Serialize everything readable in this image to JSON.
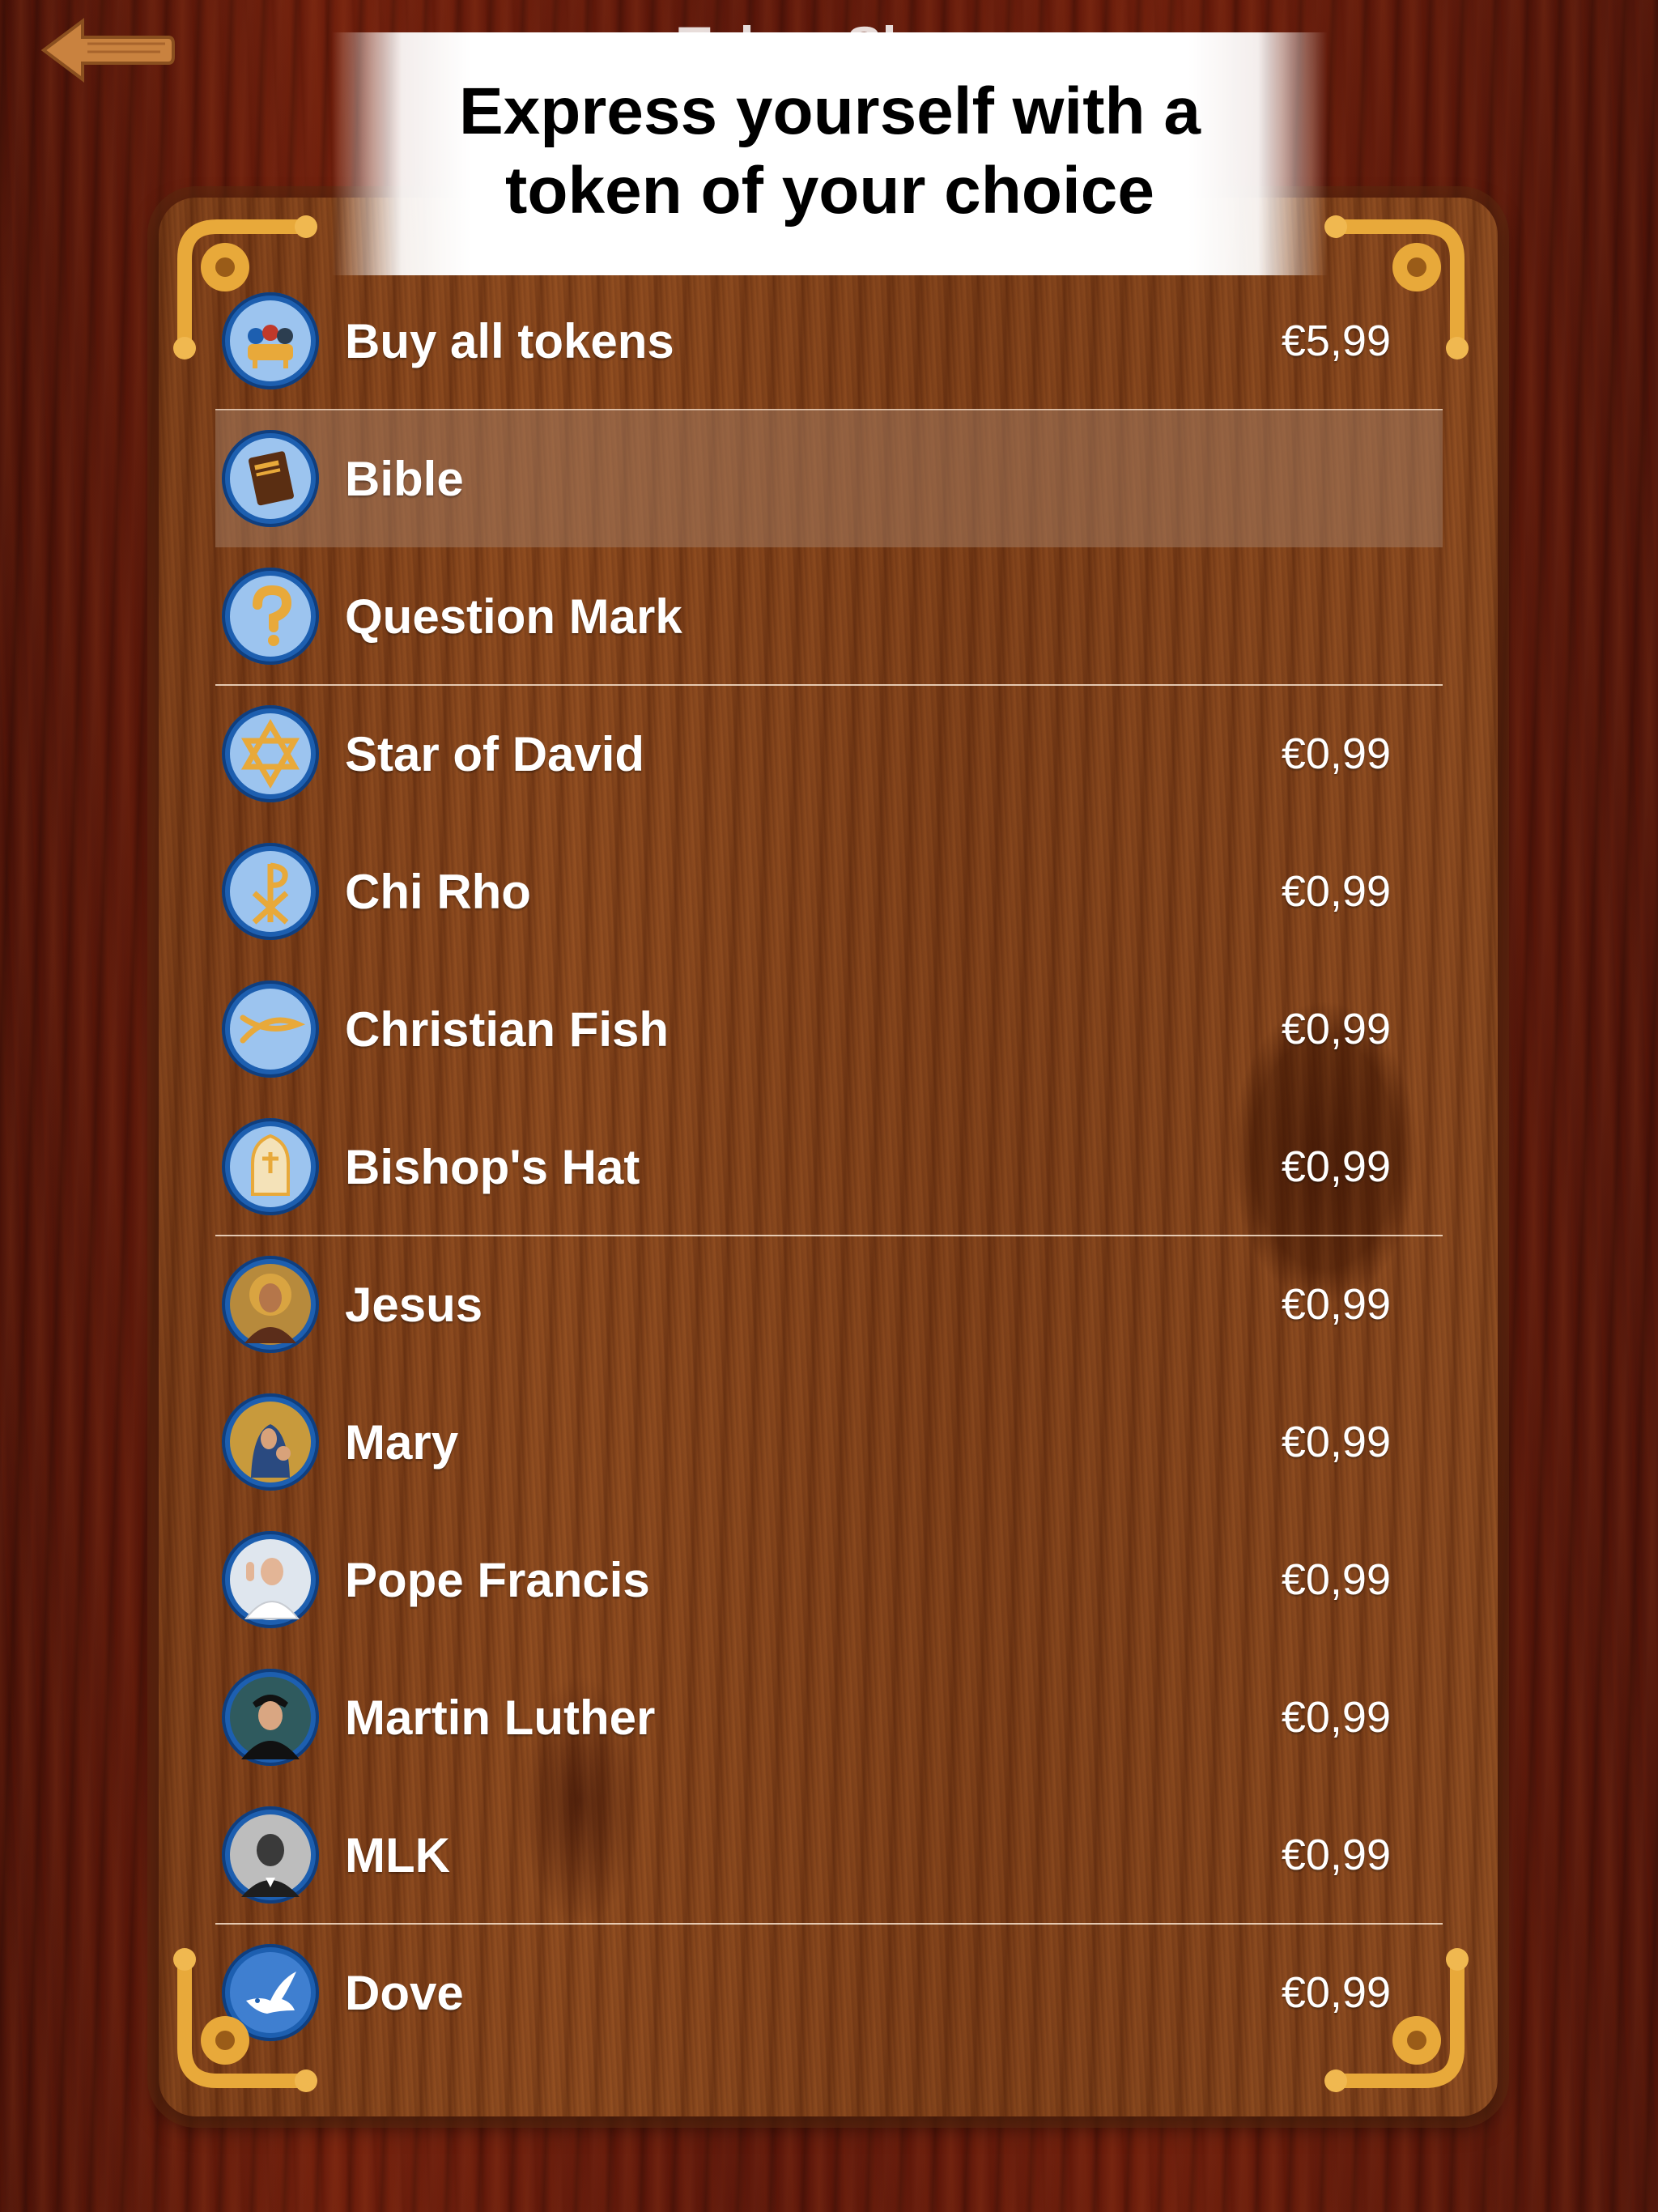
{
  "header": {
    "title": "Token Shop",
    "back_icon": "wooden-arrow-left-icon"
  },
  "banner": {
    "text": "Express yourself with a token of your choice"
  },
  "tokens": [
    {
      "name": "Buy all tokens",
      "price": "€5,99",
      "icon": "all-tokens-icon"
    },
    {
      "name": "Bible",
      "price": "",
      "icon": "bible-icon"
    },
    {
      "name": "Question Mark",
      "price": "",
      "icon": "question-mark-icon"
    },
    {
      "name": "Star of David",
      "price": "€0,99",
      "icon": "star-of-david-icon"
    },
    {
      "name": "Chi Rho",
      "price": "€0,99",
      "icon": "chi-rho-icon"
    },
    {
      "name": "Christian Fish",
      "price": "€0,99",
      "icon": "christian-fish-icon"
    },
    {
      "name": "Bishop's Hat",
      "price": "€0,99",
      "icon": "bishops-hat-icon"
    },
    {
      "name": "Jesus",
      "price": "€0,99",
      "icon": "jesus-portrait-icon"
    },
    {
      "name": "Mary",
      "price": "€0,99",
      "icon": "mary-portrait-icon"
    },
    {
      "name": "Pope Francis",
      "price": "€0,99",
      "icon": "pope-francis-portrait-icon"
    },
    {
      "name": "Martin Luther",
      "price": "€0,99",
      "icon": "martin-luther-portrait-icon"
    },
    {
      "name": "MLK",
      "price": "€0,99",
      "icon": "mlk-portrait-icon"
    },
    {
      "name": "Dove",
      "price": "€0,99",
      "icon": "dove-icon"
    }
  ],
  "colors": {
    "token_ring": "#1d5fb0",
    "token_fill": "#9cc4ef",
    "gold": "#e8a93a",
    "selected_row": "#a0785f"
  }
}
